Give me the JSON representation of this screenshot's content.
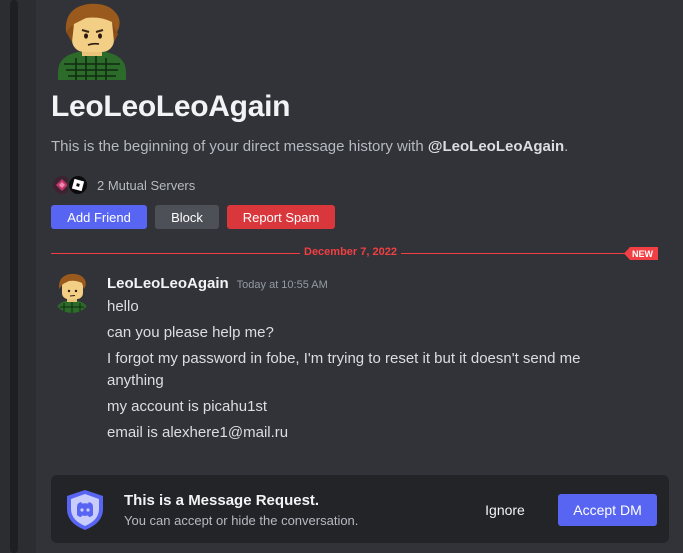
{
  "profile": {
    "username": "LeoLeoLeoAgain",
    "intro_prefix": "This is the beginning of your direct message history with ",
    "intro_handle": "@LeoLeoLeoAgain",
    "intro_suffix": ".",
    "mutual_servers": "2 Mutual Servers"
  },
  "actions": {
    "add_friend": "Add Friend",
    "block": "Block",
    "report_spam": "Report Spam"
  },
  "divider": {
    "date": "December 7, 2022",
    "badge": "NEW"
  },
  "message": {
    "author": "LeoLeoLeoAgain",
    "timestamp": "Today at 10:55 AM",
    "lines": [
      "hello",
      "can you please help me?",
      "I forgot my password in fobe, I'm trying to reset it but it doesn't send me anything",
      "my account is picahu1st",
      "email is alexhere1@mail.ru"
    ]
  },
  "request": {
    "title": "This is a Message Request.",
    "subtitle": "You can accept or hide the conversation.",
    "ignore": "Ignore",
    "accept": "Accept DM"
  },
  "icons": {
    "avatar": "blocky-avatar-icon",
    "server_1": "server-icon",
    "server_2": "roblox-server-icon",
    "request": "shield-discord-icon"
  },
  "colors": {
    "background": "#313338",
    "blurple": "#5865f2",
    "danger": "#da373c",
    "new_marker": "#f23f43",
    "secondary": "#4e5058",
    "request_bar": "#232428"
  }
}
